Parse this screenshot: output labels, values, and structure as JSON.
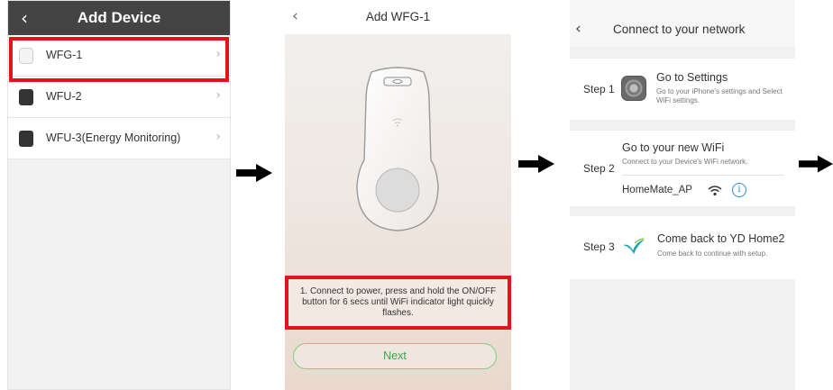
{
  "panel1": {
    "title": "Add Device",
    "back_glyph": "‹",
    "devices": [
      {
        "name": "WFG-1",
        "icon": "plug-white-icon"
      },
      {
        "name": "WFU-2",
        "icon": "plug-black-icon"
      },
      {
        "name": "WFU-3(Energy Monitoring)",
        "icon": "plug-black-icon"
      }
    ],
    "chevron": "›",
    "highlight_color": "#e2141b"
  },
  "panel2": {
    "title": "Add WFG-1",
    "back_glyph": "‹",
    "instruction": "1. Connect to power, press and hold the ON/OFF button for 6 secs until WiFi indicator light quickly flashes.",
    "next_label": "Next",
    "accent": "#3aa34a"
  },
  "panel3": {
    "title": "Connect to your network",
    "back_glyph": "‹",
    "steps": [
      {
        "label": "Step 1",
        "heading": "Go to Settings",
        "sub": "Go to your iPhone's settings and Select WiFi settings."
      },
      {
        "label": "Step 2",
        "heading": "Go to your new WiFi",
        "sub": "Connect to your Device's WiFi network.",
        "network": "HomeMate_AP"
      },
      {
        "label": "Step 3",
        "heading": "Come back to YD Home2",
        "sub": "Come back to continue with setup."
      }
    ],
    "info_glyph": "i",
    "info_color": "#2f8ad8"
  }
}
